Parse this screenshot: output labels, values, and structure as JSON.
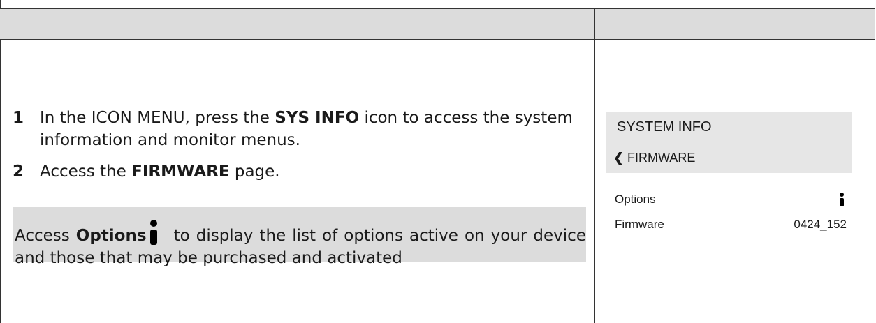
{
  "steps": [
    {
      "number": "1",
      "text_before": "In the ICON MENU, press the ",
      "bold": "SYS INFO",
      "text_after": " icon to access the system information and monitor menus."
    },
    {
      "number": "2",
      "text_before": "Access the ",
      "bold": "FIRMWARE",
      "text_after": " page."
    }
  ],
  "note": {
    "text_before": "Access ",
    "bold": "Options",
    "icon": "info-icon",
    "text_after": " to display the list of options active on your device and those that may be purchased and activated"
  },
  "screen": {
    "title": "SYSTEM INFO",
    "back_label": "FIRMWARE",
    "back_icon": "chevron-left-icon",
    "rows": [
      {
        "label": "Options",
        "value": "",
        "icon": "info-icon"
      },
      {
        "label": "Firmware",
        "value": "0424_152"
      }
    ]
  }
}
